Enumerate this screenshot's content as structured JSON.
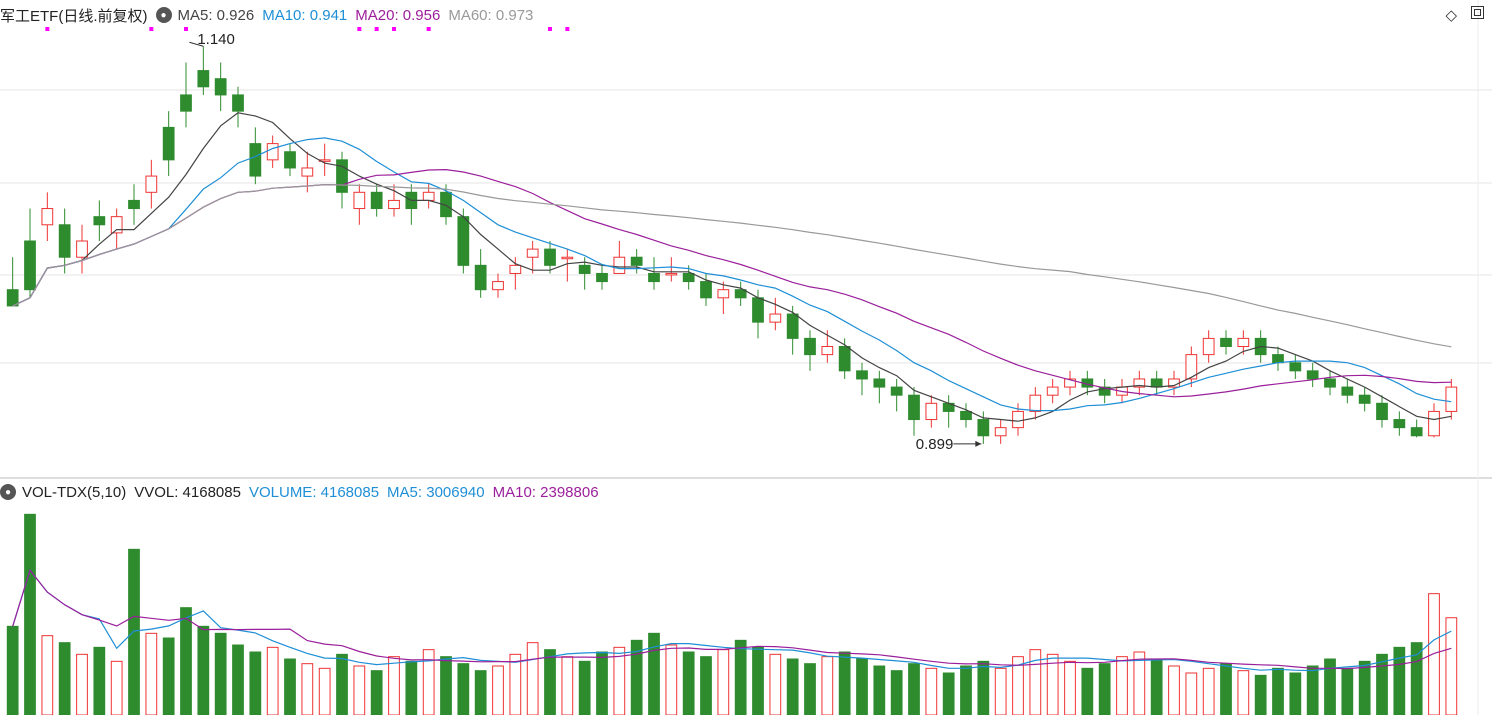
{
  "price_panel": {
    "title": "军工ETF(日线.前复权)",
    "ma_labels": [
      {
        "text": "MA5: 0.926",
        "color": "#444444"
      },
      {
        "text": "MA10: 0.941",
        "color": "#1e8fd6"
      },
      {
        "text": "MA20: 0.956",
        "color": "#9b1f9b"
      },
      {
        "text": "MA60: 0.973",
        "color": "#999999"
      }
    ],
    "high_label": "1.140",
    "low_label": "0.899"
  },
  "volume_panel": {
    "labels": [
      {
        "text": "VOL-TDX(5,10)",
        "color": "#222222"
      },
      {
        "text": "VVOL: 4168085",
        "color": "#222222"
      },
      {
        "text": "VOLUME: 4168085",
        "color": "#1e8fd6"
      },
      {
        "text": "MA5: 3006940",
        "color": "#1e8fd6"
      },
      {
        "text": "MA10: 2398806",
        "color": "#9b1f9b"
      }
    ]
  },
  "icons": {
    "settings": "circle-dot-icon",
    "diamond": "diamond-icon",
    "window": "window-icon"
  },
  "colors": {
    "up": "#ee3333",
    "down": "#2e8b2e",
    "ma5": "#444444",
    "ma10": "#1e8fd6",
    "ma20": "#9b1f9b",
    "ma60": "#999999",
    "grid": "#e6e6e6",
    "marker": "#ff00ff"
  },
  "chart_data": {
    "type": "candlestick",
    "x": [],
    "ylim_price": [
      0.89,
      1.15
    ],
    "ylim_volume": [
      0,
      9000000
    ],
    "candles": [
      [
        0.99,
        0.98,
        1.01,
        0.98
      ],
      [
        1.02,
        0.99,
        1.04,
        0.985
      ],
      [
        1.03,
        1.04,
        1.05,
        1.02
      ],
      [
        1.03,
        1.01,
        1.04,
        1.0
      ],
      [
        1.01,
        1.02,
        1.03,
        1.0
      ],
      [
        1.035,
        1.03,
        1.045,
        1.02
      ],
      [
        1.025,
        1.035,
        1.04,
        1.015
      ],
      [
        1.045,
        1.04,
        1.055,
        1.03
      ],
      [
        1.05,
        1.06,
        1.07,
        1.04
      ],
      [
        1.09,
        1.07,
        1.1,
        1.06
      ],
      [
        1.11,
        1.1,
        1.13,
        1.09
      ],
      [
        1.125,
        1.115,
        1.14,
        1.11
      ],
      [
        1.12,
        1.11,
        1.13,
        1.1
      ],
      [
        1.11,
        1.1,
        1.115,
        1.09
      ],
      [
        1.08,
        1.06,
        1.09,
        1.055
      ],
      [
        1.07,
        1.08,
        1.085,
        1.065
      ],
      [
        1.075,
        1.065,
        1.08,
        1.06
      ],
      [
        1.06,
        1.065,
        1.075,
        1.05
      ],
      [
        1.07,
        1.07,
        1.08,
        1.06
      ],
      [
        1.07,
        1.05,
        1.075,
        1.04
      ],
      [
        1.04,
        1.05,
        1.055,
        1.03
      ],
      [
        1.05,
        1.04,
        1.055,
        1.035
      ],
      [
        1.04,
        1.045,
        1.055,
        1.035
      ],
      [
        1.05,
        1.04,
        1.055,
        1.03
      ],
      [
        1.045,
        1.05,
        1.055,
        1.04
      ],
      [
        1.05,
        1.035,
        1.055,
        1.03
      ],
      [
        1.035,
        1.005,
        1.04,
        1.0
      ],
      [
        1.005,
        0.99,
        1.015,
        0.985
      ],
      [
        0.99,
        0.995,
        1.0,
        0.985
      ],
      [
        1.0,
        1.005,
        1.01,
        0.99
      ],
      [
        1.01,
        1.015,
        1.02,
        1.0
      ],
      [
        1.015,
        1.005,
        1.02,
        1.0
      ],
      [
        1.01,
        1.01,
        1.015,
        0.995
      ],
      [
        1.005,
        1.0,
        1.01,
        0.99
      ],
      [
        1.0,
        0.995,
        1.005,
        0.99
      ],
      [
        1.0,
        1.01,
        1.02,
        1.0
      ],
      [
        1.01,
        1.005,
        1.015,
        1.0
      ],
      [
        1.0,
        0.995,
        1.01,
        0.99
      ],
      [
        1.0,
        1.0,
        1.01,
        0.995
      ],
      [
        1.0,
        0.995,
        1.005,
        0.99
      ],
      [
        0.995,
        0.985,
        1.0,
        0.98
      ],
      [
        0.985,
        0.99,
        0.995,
        0.975
      ],
      [
        0.99,
        0.985,
        0.995,
        0.98
      ],
      [
        0.985,
        0.97,
        0.99,
        0.96
      ],
      [
        0.97,
        0.975,
        0.985,
        0.965
      ],
      [
        0.975,
        0.96,
        0.98,
        0.95
      ],
      [
        0.96,
        0.95,
        0.965,
        0.94
      ],
      [
        0.95,
        0.955,
        0.965,
        0.945
      ],
      [
        0.955,
        0.94,
        0.96,
        0.935
      ],
      [
        0.94,
        0.935,
        0.945,
        0.925
      ],
      [
        0.935,
        0.93,
        0.94,
        0.92
      ],
      [
        0.93,
        0.925,
        0.935,
        0.915
      ],
      [
        0.925,
        0.91,
        0.93,
        0.9
      ],
      [
        0.91,
        0.92,
        0.925,
        0.905
      ],
      [
        0.92,
        0.915,
        0.925,
        0.905
      ],
      [
        0.915,
        0.91,
        0.92,
        0.905
      ],
      [
        0.91,
        0.9,
        0.915,
        0.895
      ],
      [
        0.9,
        0.905,
        0.91,
        0.895
      ],
      [
        0.905,
        0.915,
        0.92,
        0.9
      ],
      [
        0.915,
        0.925,
        0.93,
        0.91
      ],
      [
        0.925,
        0.93,
        0.935,
        0.92
      ],
      [
        0.93,
        0.935,
        0.94,
        0.925
      ],
      [
        0.935,
        0.93,
        0.94,
        0.925
      ],
      [
        0.93,
        0.925,
        0.935,
        0.92
      ],
      [
        0.925,
        0.93,
        0.935,
        0.92
      ],
      [
        0.93,
        0.935,
        0.94,
        0.925
      ],
      [
        0.935,
        0.93,
        0.94,
        0.925
      ],
      [
        0.93,
        0.935,
        0.94,
        0.925
      ],
      [
        0.935,
        0.95,
        0.955,
        0.93
      ],
      [
        0.95,
        0.96,
        0.965,
        0.945
      ],
      [
        0.96,
        0.955,
        0.965,
        0.95
      ],
      [
        0.955,
        0.96,
        0.965,
        0.95
      ],
      [
        0.96,
        0.95,
        0.965,
        0.945
      ],
      [
        0.95,
        0.945,
        0.955,
        0.94
      ],
      [
        0.945,
        0.94,
        0.95,
        0.935
      ],
      [
        0.94,
        0.935,
        0.945,
        0.93
      ],
      [
        0.935,
        0.93,
        0.94,
        0.925
      ],
      [
        0.93,
        0.925,
        0.935,
        0.92
      ],
      [
        0.925,
        0.92,
        0.93,
        0.915
      ],
      [
        0.92,
        0.91,
        0.925,
        0.905
      ],
      [
        0.91,
        0.905,
        0.915,
        0.9
      ],
      [
        0.905,
        0.9,
        0.91,
        0.899
      ],
      [
        0.9,
        0.915,
        0.92,
        0.899
      ],
      [
        0.915,
        0.93,
        0.935,
        0.91
      ]
    ],
    "volume": [
      3800000,
      8600000,
      3400000,
      3100000,
      2600000,
      2900000,
      2300000,
      7100000,
      3500000,
      3300000,
      4600000,
      3800000,
      3500000,
      3000000,
      2700000,
      2900000,
      2400000,
      2200000,
      2000000,
      2600000,
      2100000,
      1900000,
      2500000,
      2300000,
      2800000,
      2500000,
      2200000,
      1900000,
      2100000,
      2600000,
      3100000,
      2800000,
      2500000,
      2300000,
      2700000,
      2900000,
      3200000,
      3500000,
      3000000,
      2700000,
      2500000,
      2800000,
      3200000,
      2900000,
      2600000,
      2400000,
      2200000,
      2500000,
      2700000,
      2400000,
      2100000,
      1900000,
      2200000,
      2000000,
      1800000,
      2100000,
      2300000,
      2000000,
      2500000,
      2800000,
      2600000,
      2300000,
      2000000,
      2200000,
      2500000,
      2700000,
      2400000,
      2100000,
      1800000,
      2000000,
      2200000,
      1900000,
      1700000,
      2000000,
      1800000,
      2100000,
      2400000,
      2000000,
      2300000,
      2600000,
      2900000,
      3100000,
      5200000,
      4168085
    ]
  }
}
